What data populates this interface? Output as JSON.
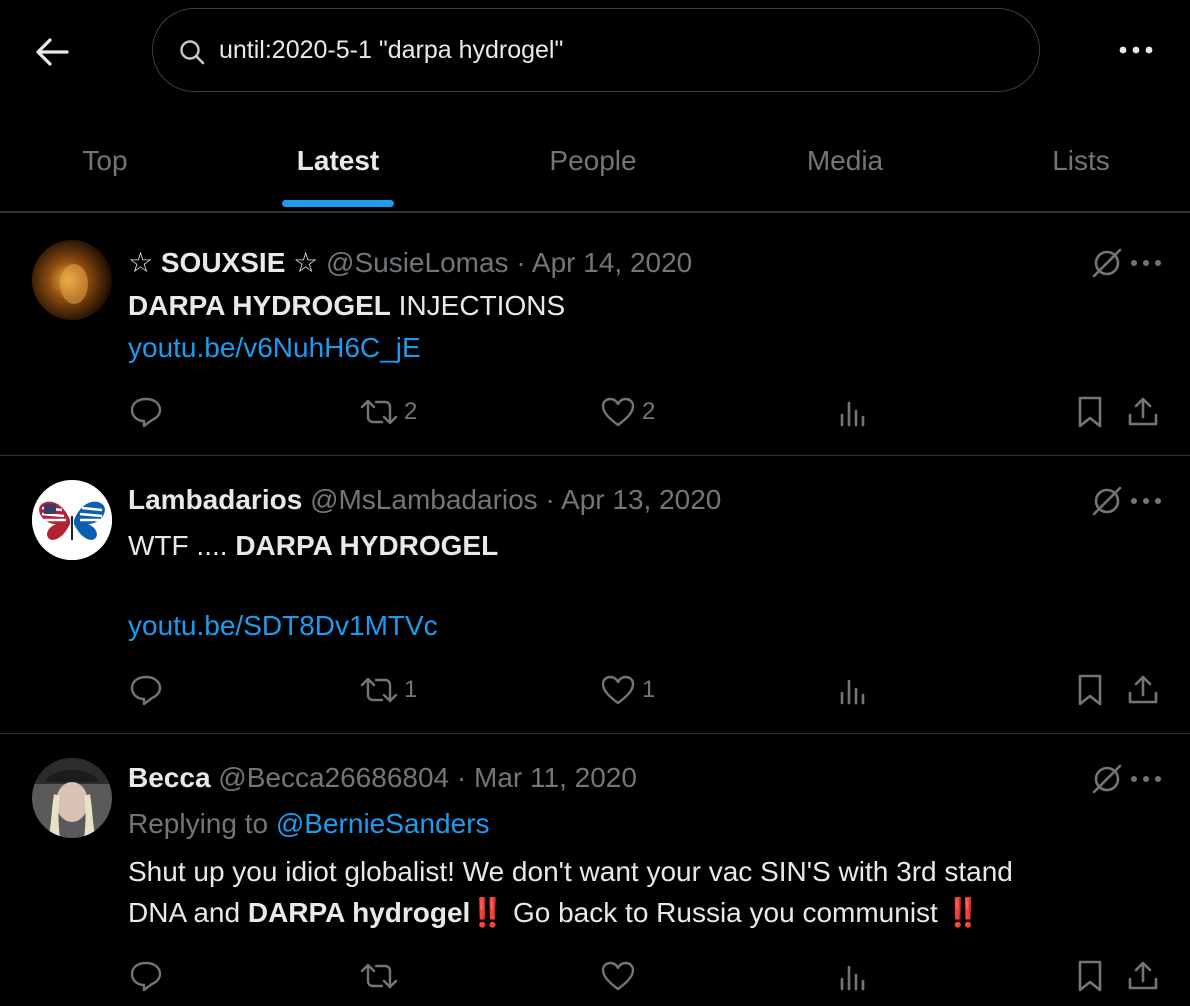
{
  "search": {
    "query": "until:2020-5-1 \"darpa hydrogel\""
  },
  "tabs": [
    {
      "label": "Top"
    },
    {
      "label": "Latest"
    },
    {
      "label": "People"
    },
    {
      "label": "Media"
    },
    {
      "label": "Lists"
    }
  ],
  "active_tab": "Latest",
  "tweets": [
    {
      "display_name": "☆ SOUXSIE ☆",
      "handle": "@SusieLomas",
      "date": "Apr 14, 2020",
      "text_bold": "DARPA HYDROGEL",
      "text_rest": " INJECTIONS",
      "link": "youtu.be/v6NuhH6C_jE",
      "retweets": "2",
      "likes": "2"
    },
    {
      "display_name": "Lambadarios",
      "handle": "@MsLambadarios",
      "date": "Apr 13, 2020",
      "text_prefix": "WTF .... ",
      "text_bold": "DARPA HYDROGEL",
      "link": "youtu.be/SDT8Dv1MTVc",
      "retweets": "1",
      "likes": "1"
    },
    {
      "display_name": "Becca",
      "handle": "@Becca26686804",
      "date": "Mar 11, 2020",
      "replying_prefix": "Replying to ",
      "replying_to": "@BernieSanders",
      "line1": "Shut up you idiot globalist! We don't want your vac SIN'S with 3rd stand",
      "line2_prefix": "DNA and ",
      "line2_bold": "DARPA hydrogel",
      "line2_mid": " Go back to Russia you communist ",
      "emoji": "‼️",
      "retweets": "",
      "likes": ""
    }
  ],
  "dot_separator": "·",
  "colors": {
    "accent": "#1d9bf0",
    "muted": "#71767b",
    "text": "#e7e9ea",
    "background": "#000000",
    "border": "#2f3336"
  }
}
